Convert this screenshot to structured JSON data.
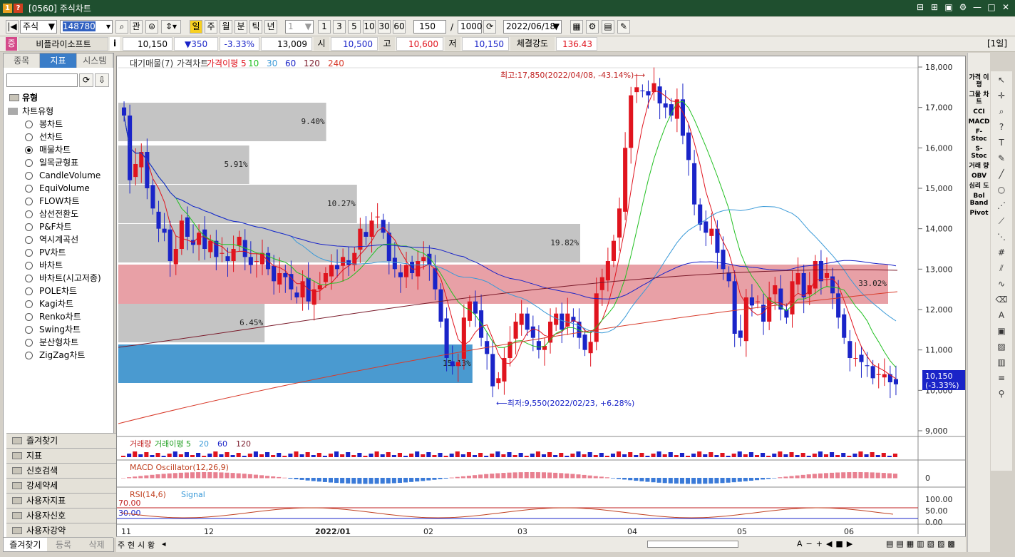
{
  "window": {
    "code_icons": [
      "1",
      "?"
    ],
    "title": "[0560] 주식차트",
    "controls": [
      "⊟",
      "⊞",
      "▣",
      "⚙",
      "—",
      "□",
      "✕"
    ]
  },
  "toolbar": {
    "market": "주식",
    "code": "148780",
    "btn_gwan": "관",
    "period": [
      "일",
      "주",
      "월",
      "분",
      "틱",
      "년"
    ],
    "interval_sel": "1",
    "intervals": [
      "1",
      "3",
      "5",
      "10",
      "30",
      "60"
    ],
    "count": "150",
    "total": "1000",
    "date": "2022/06/18"
  },
  "quote": {
    "marker": "증",
    "name": "비플라이소프트",
    "info": "i",
    "price": "10,150",
    "change": "▼350",
    "pct": "-3.33%",
    "volume": "13,009",
    "open_label": "시",
    "open": "10,500",
    "high_label": "고",
    "high": "10,600",
    "low_label": "저",
    "low": "10,150",
    "strength_label": "체결강도",
    "strength": "136.43",
    "period_badge": "[1일]"
  },
  "left": {
    "tabs": [
      "종목",
      "지표",
      "시스템"
    ],
    "active_tab": 1,
    "section": "유형",
    "group": "차트유형",
    "types": [
      "봉차트",
      "선차트",
      "매물차트",
      "일목균형표",
      "CandleVolume",
      "EquiVolume",
      "FLOW차트",
      "삼선전환도",
      "P&F차트",
      "역시계곡선",
      "PV차트",
      "바차트",
      "바차트(시고저종)",
      "POLE차트",
      "Kagi차트",
      "Renko차트",
      "Swing차트",
      "분산형차트",
      "ZigZag차트"
    ],
    "selected_type": 2,
    "accordion": [
      "즐겨찾기",
      "지표",
      "신호검색",
      "강세약세",
      "사용자지표",
      "사용자신호",
      "사용자강약"
    ],
    "bottom_tabs": [
      "즐겨찾기",
      "등록",
      "삭제"
    ]
  },
  "legend": {
    "main": [
      "대기매물(7)",
      "가격차트",
      "가격이평 5",
      "10",
      "30",
      "60",
      "120",
      "240"
    ],
    "vol": [
      "거래량",
      "거래이평 5",
      "20",
      "60",
      "120"
    ],
    "macd": "MACD Oscillator(12,26,9)",
    "rsi": [
      "RSI(14,6)",
      "Signal"
    ]
  },
  "annotations": {
    "high": "최고:17,850(2022/04/08, -43.14%)⟶",
    "low": "⟵최저:9,550(2022/02/23, +6.28%)",
    "cur_price": "10,150",
    "cur_pct": "(-3.33%)"
  },
  "volume_profile": [
    {
      "label": "9.40%",
      "width": 0.27
    },
    {
      "label": "5.91%",
      "width": 0.17
    },
    {
      "label": "10.27%",
      "width": 0.31
    },
    {
      "label": "19.82%",
      "width": 0.6
    },
    {
      "label": "33.02%",
      "width": 1.0
    },
    {
      "label": "6.45%",
      "width": 0.19
    },
    {
      "label": "15.13%",
      "width": 0.46
    }
  ],
  "price_axis": [
    "18,000",
    "17,000",
    "16,000",
    "15,000",
    "14,000",
    "13,000",
    "12,000",
    "11,000",
    "10,000",
    "9,000"
  ],
  "x_axis": [
    "11",
    "12",
    "2022/01",
    "02",
    "03",
    "04",
    "05",
    "06"
  ],
  "macd_axis": "0",
  "rsi_axis": [
    "100.00",
    "50.00",
    "0.00"
  ],
  "rsi_levels": [
    "70.00",
    "30.00"
  ],
  "right_tools": [
    "가격 이평",
    "그물 차트",
    "CCI",
    "MACD",
    "F-Stoc",
    "S-Stoc",
    "거래 량",
    "OBV",
    "심리 도",
    "Bol Band",
    "Pivot"
  ],
  "bottom_left": [
    "주",
    "현",
    "시",
    "황"
  ],
  "colors": {
    "up": "#e0141e",
    "down": "#1a24c8",
    "ma5": "#e0141e",
    "ma10": "#22c022",
    "ma30": "#3a9ad8",
    "ma60": "#1a24c8",
    "ma120": "#7a1a2a",
    "ma240": "#d83a2a",
    "vp_gray": "#c4c4c4",
    "vp_red": "#e8a0a6",
    "vp_blue": "#4a9ad0"
  },
  "chart_data": [
    {
      "type": "candlestick",
      "title": "",
      "y_axis": {
        "min": 9000,
        "max": 18000
      },
      "high": {
        "value": 17850,
        "date": "2022/04/08"
      },
      "low": {
        "value": 9550,
        "date": "2022/02/23"
      },
      "last": 10150,
      "closes": [
        16800,
        15200,
        15600,
        15900,
        15000,
        14500,
        14000,
        13900,
        13200,
        13500,
        14200,
        13800,
        13600,
        13900,
        13500,
        13700,
        13300,
        13400,
        13200,
        13500,
        13800,
        13300,
        13100,
        13200,
        13400,
        13000,
        12700,
        12900,
        12800,
        12500,
        12300,
        12700,
        12200,
        12500,
        12600,
        12900,
        13100,
        13000,
        13300,
        13100,
        13400,
        14000,
        13800,
        14200,
        14300,
        13900,
        13200,
        13000,
        12800,
        13100,
        12900,
        13200,
        13300,
        13100,
        12500,
        11700,
        10800,
        10600,
        10700,
        11800,
        12200,
        11900,
        11300,
        10900,
        10100,
        10300,
        10800,
        11200,
        11700,
        11900,
        11500,
        11300,
        11000,
        11100,
        11700,
        11900,
        11500,
        11900,
        11700,
        11300,
        11000,
        11200,
        12400,
        12800,
        13200,
        13700,
        14500,
        16000,
        17300,
        17500,
        17400,
        17300,
        17600,
        17100,
        17000,
        16800,
        17200,
        16300,
        15700,
        14600,
        14100,
        13900,
        14000,
        13400,
        13000,
        12700,
        11400,
        11300,
        12300,
        12100,
        12200,
        11700,
        12300,
        12600,
        12000,
        11800,
        12700,
        12900,
        12300,
        12600,
        13200,
        12700,
        12900,
        12400,
        11800,
        11300,
        10800,
        10800,
        10700,
        10600,
        10300,
        10400,
        10400,
        10200,
        10150
      ]
    },
    {
      "type": "bar",
      "title": "거래량",
      "values": "small bars"
    },
    {
      "type": "bar",
      "title": "MACD Oscillator(12,26,9)"
    },
    {
      "type": "line",
      "title": "RSI(14,6)",
      "y_axis": {
        "min": 0,
        "max": 100
      }
    }
  ]
}
